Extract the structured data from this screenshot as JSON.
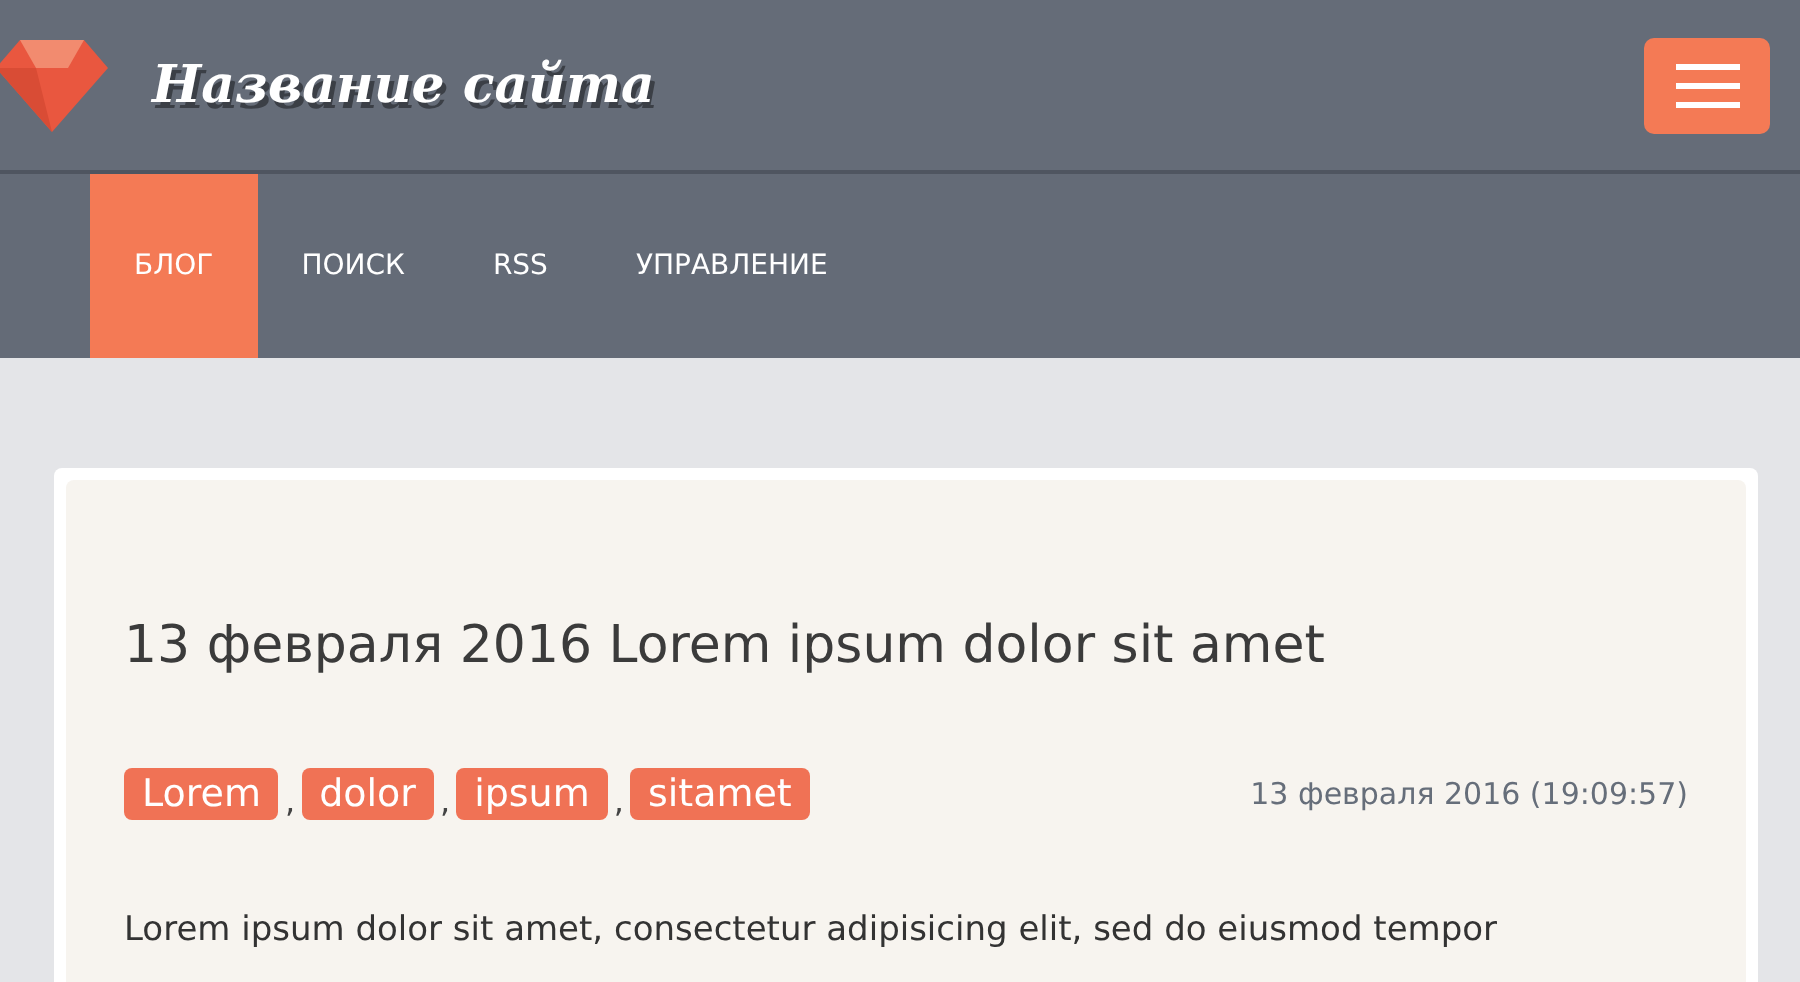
{
  "header": {
    "site_title": "Название сайта"
  },
  "nav": [
    {
      "label": "БЛОГ",
      "selected": true
    },
    {
      "label": "ПОИСК",
      "selected": false
    },
    {
      "label": "RSS",
      "selected": false
    },
    {
      "label": "УПРАВЛЕНИЕ",
      "selected": false
    }
  ],
  "post": {
    "title": "13 февраля 2016 Lorem ipsum dolor sit amet",
    "tags": [
      "Lorem",
      "dolor",
      "ipsum",
      "sitamet"
    ],
    "tag_separator": ",",
    "date": "13 февраля 2016 (19:09:57)",
    "body": "Lorem ipsum dolor sit amet, consectetur adipisicing elit, sed do eiusmod tempor"
  }
}
